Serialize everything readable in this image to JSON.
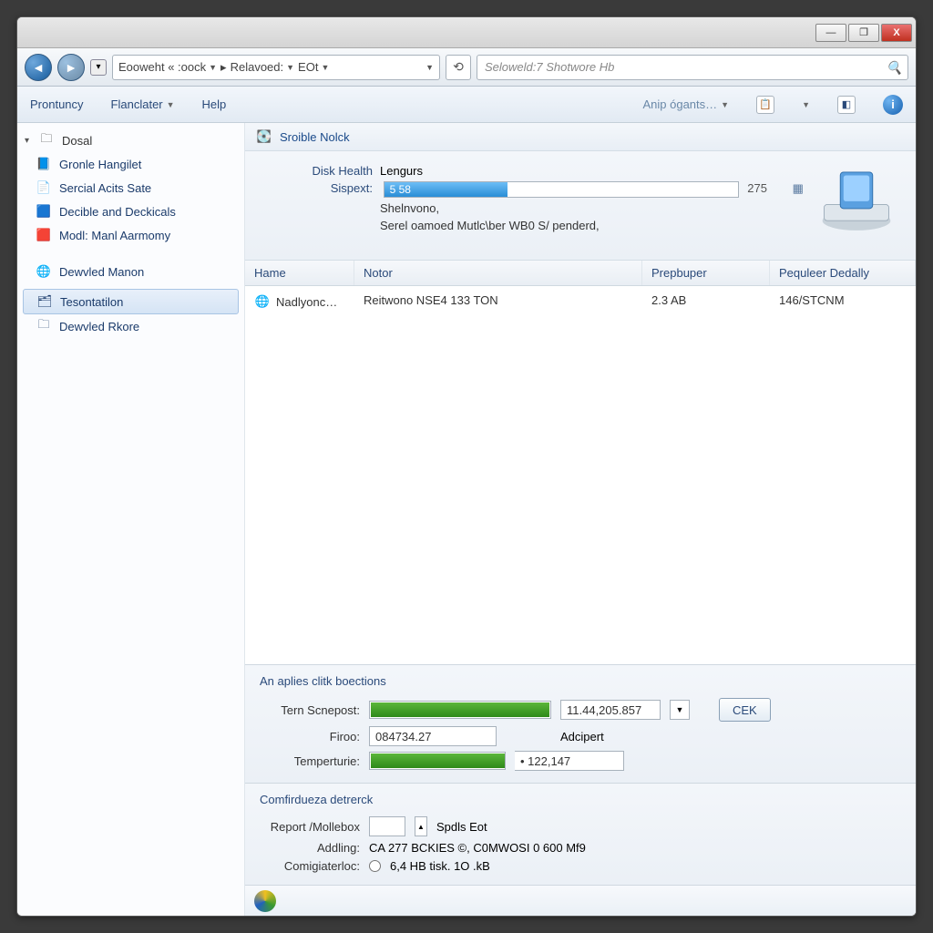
{
  "titlebar": {
    "min": "—",
    "max": "❐",
    "close": "X"
  },
  "nav": {
    "crumbs": [
      "Eooweht « :oock",
      "Relavoed:",
      "EOt"
    ],
    "search_placeholder": "Seloweld:7 Shotwore Hb"
  },
  "menu": {
    "items": [
      "Prontuncy",
      "Flanclater",
      "Help"
    ],
    "right_label": "Anip ógants…"
  },
  "sidebar": {
    "root": "Dosal",
    "group1": [
      "Gronle Hangilet",
      "Sercial Acits Sate",
      "Decible and Deckicals",
      "Modl: Manl Aarmomy"
    ],
    "group2_header": "Dewvled Manon",
    "group2": [
      "Tesontatilon",
      "Dewvled Rkore"
    ]
  },
  "section": {
    "title": "Sroible Nolck"
  },
  "detail": {
    "health_label": "Disk Health",
    "health_value": "Lengurs",
    "spec_label": "Sispext:",
    "spec_bar_text": "5 58",
    "spec_end": "275",
    "sub1": "Shelnvono,",
    "sub2": "Serel oamoed Mutlc\\ber WB0 S/ penderd,"
  },
  "table": {
    "cols": [
      "Hame",
      "Notor",
      "Prepbuper",
      "Pequleer Dedally"
    ],
    "row": {
      "c1": "Nadlyonc…",
      "c2": "Reitwono NSE4 133 TON",
      "c3": "2.3 AB",
      "c4": "146/STCNM"
    }
  },
  "panel1": {
    "title": "An aplies clitk boections",
    "r1_label": "Tern Scnepost:",
    "r1_val": "11.44,205.857",
    "btn": "CEK",
    "r2_label": "Firoo:",
    "r2_val": "084734.27",
    "r2_after": "Adcipert",
    "r3_label": "Temperturie:",
    "r3_val": "• 122,147"
  },
  "panel2": {
    "title": "Comfirdueza detrerck",
    "r1_label": "Report /Mollebox",
    "r1_after": "Spdls Eot",
    "r2_label": "Addling:",
    "r2_val": "CA 277 BCKIES ©, C0MWOSI 0 600 Mf9",
    "r3_label": "Comigiaterloc:",
    "r3_val": "6,4 HB tisk. 1O .kB"
  }
}
